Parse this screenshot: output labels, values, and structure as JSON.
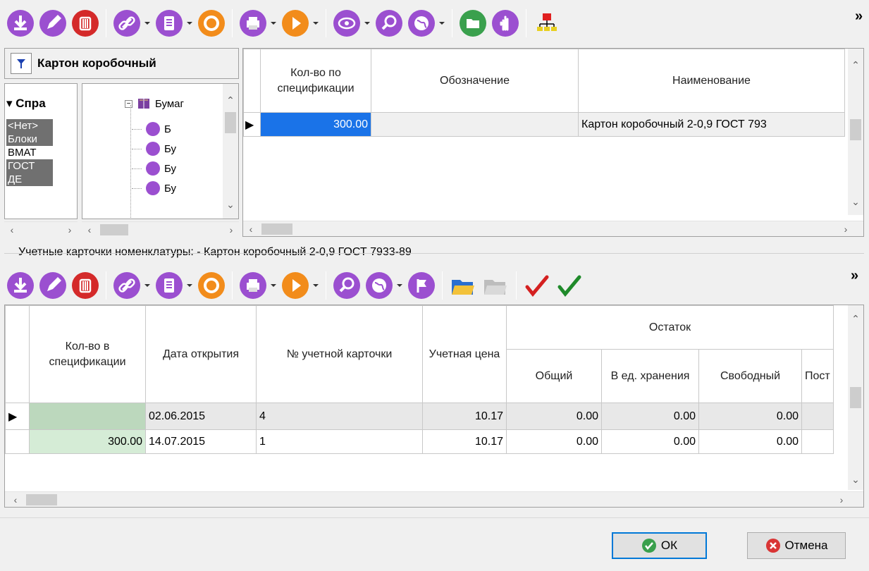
{
  "colors": {
    "purple": "#9b4fd0",
    "red": "#d42a2a",
    "orange": "#f28c1b",
    "green": "#3aa04d",
    "selection": "#1a73e8",
    "gridgreen": "#d5ecd6"
  },
  "top_toolbar": {
    "icons": [
      "download-icon",
      "edit-icon",
      "delete-icon",
      "link-icon",
      "document-icon",
      "refresh-icon",
      "print-icon",
      "play-icon",
      "view-icon",
      "search-icon",
      "globe-icon",
      "open-folder-icon",
      "hand-icon",
      "network-icon"
    ],
    "more": "»"
  },
  "left_panel": {
    "title": "Картон коробочный",
    "group_label": "Спра",
    "list_items": [
      "<Нет>",
      "Блоки",
      "ВМАТ",
      "ГОСТ",
      "ДЕ"
    ],
    "tree_root": "Бумаг",
    "tree_children": [
      "Б",
      "Бу",
      "Бу",
      "Бу"
    ]
  },
  "spec_table": {
    "columns": [
      "Кол-во по спецификации",
      "Обозначение",
      "Наименование"
    ],
    "rows": [
      {
        "qty": "300.00",
        "designation": "",
        "name": "Картон коробочный 2-0,9 ГОСТ 793"
      }
    ]
  },
  "cards_section": {
    "label": "Учетные карточки номенклатуры: - Картон коробочный 2-0,9 ГОСТ 7933-89",
    "more": "»",
    "columns": {
      "qty": "Кол-во в спецификации",
      "date": "Дата открытия",
      "card_no": "№ учетной карточки",
      "price": "Учетная цена",
      "remainder": "Остаток",
      "total": "Общий",
      "storage": "В ед. хранения",
      "free": "Свободный",
      "post": "Пост"
    },
    "rows": [
      {
        "qty": "",
        "date": "02.06.2015",
        "card_no": "4",
        "price": "10.17",
        "total": "0.00",
        "storage": "0.00",
        "free": "0.00"
      },
      {
        "qty": "300.00",
        "date": "14.07.2015",
        "card_no": "1",
        "price": "10.17",
        "total": "0.00",
        "storage": "0.00",
        "free": "0.00"
      }
    ]
  },
  "buttons": {
    "ok": "ОК",
    "cancel": "Отмена"
  }
}
